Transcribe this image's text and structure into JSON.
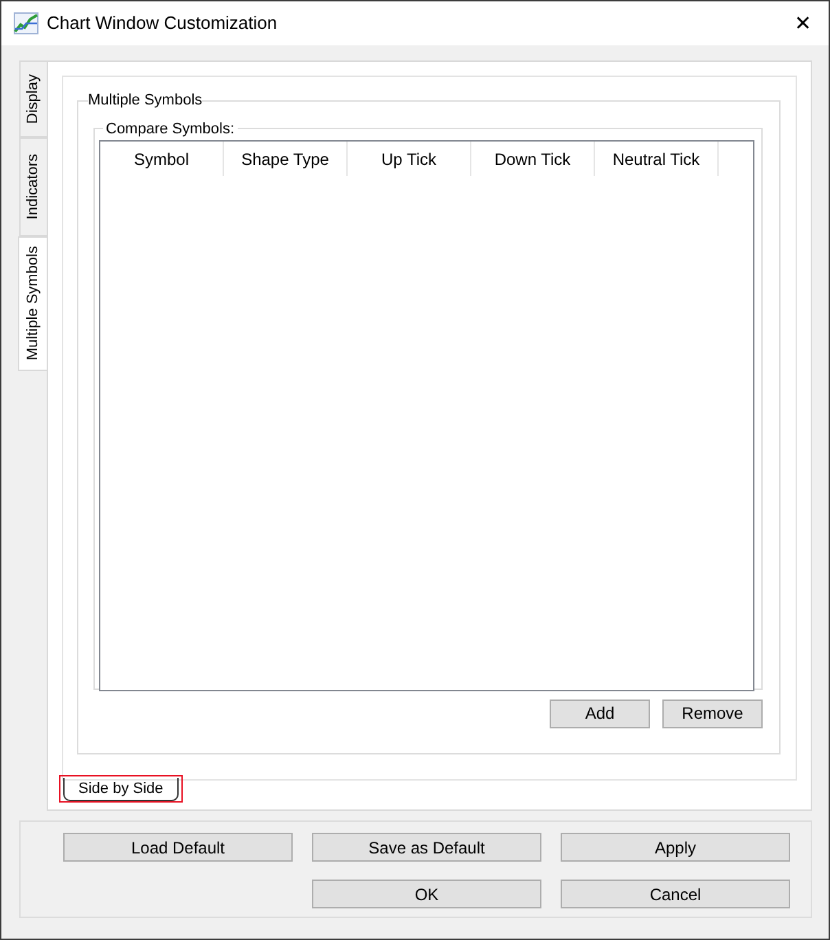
{
  "window": {
    "title": "Chart Window Customization",
    "close": "✕"
  },
  "side_tabs": [
    {
      "label": "Display",
      "selected": false
    },
    {
      "label": "Indicators",
      "selected": false
    },
    {
      "label": "Multiple Symbols",
      "selected": true
    }
  ],
  "group": {
    "title": "Multiple Symbols",
    "compare": {
      "title": "Compare Symbols:",
      "table": {
        "columns": [
          "Symbol",
          "Shape Type",
          "Up Tick",
          "Down Tick",
          "Neutral Tick"
        ]
      }
    },
    "buttons": [
      "Add",
      "Remove"
    ]
  },
  "bottom_tab": {
    "label": "Side by Side",
    "highlighted": true
  },
  "buttons": [
    [
      "Load Default",
      "Save as Default",
      "Apply"
    ],
    [
      "OK",
      "Cancel"
    ]
  ]
}
